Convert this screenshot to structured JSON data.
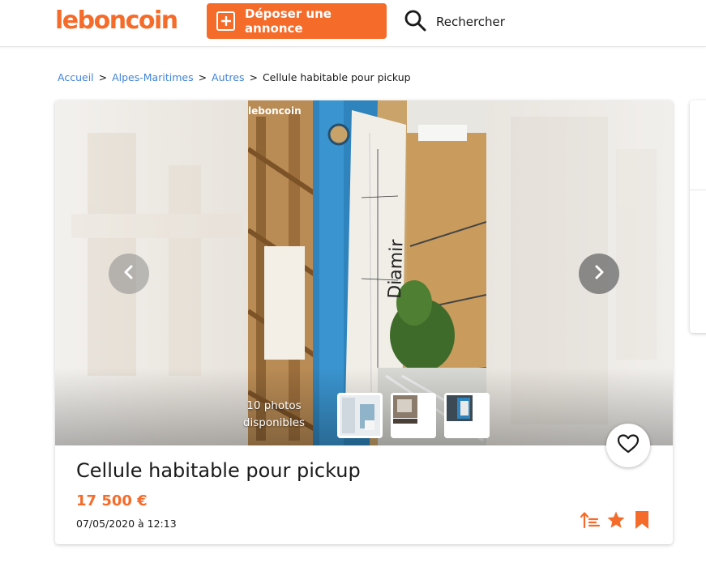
{
  "header": {
    "logo": "leboncoin",
    "deposit_label": "Déposer une annonce",
    "search_label": "Rechercher"
  },
  "breadcrumb": {
    "items": [
      "Accueil",
      "Alpes-Maritimes",
      "Autres"
    ],
    "current": "Cellule habitable pour pickup",
    "separator": ">"
  },
  "listing": {
    "photo_watermark": "leboncoin",
    "photo_text": "Diamir",
    "photos_count": "10 photos",
    "photos_count_suffix": "disponibles",
    "title": "Cellule habitable pour pickup",
    "price": "17 500 €",
    "date": "07/05/2020 à 12:13"
  },
  "colors": {
    "brand": "#f56b2a",
    "link": "#4183d7"
  },
  "icons": [
    "plus-square-icon",
    "search-icon",
    "chevron-left-icon",
    "chevron-right-icon",
    "heart-icon",
    "sort-icon",
    "star-icon",
    "bookmark-icon"
  ]
}
